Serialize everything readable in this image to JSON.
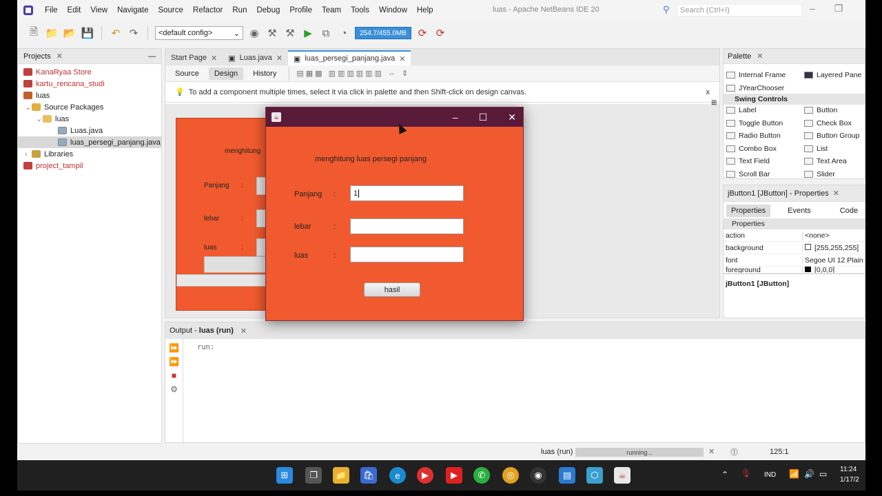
{
  "menubar": {
    "items": [
      "File",
      "Edit",
      "View",
      "Navigate",
      "Source",
      "Refactor",
      "Run",
      "Debug",
      "Profile",
      "Team",
      "Tools",
      "Window",
      "Help"
    ],
    "window_title": "luas - Apache NetBeans IDE 20",
    "search_placeholder": "Search (Ctrl+I)"
  },
  "toolbar": {
    "config": "<default config>",
    "memory": "254.7/455.0MB"
  },
  "projects": {
    "tab": "Projects",
    "items": [
      "KanaRyaa Store",
      "kartu_rencana_studi",
      "luas",
      "Source Packages",
      "luas",
      "Luas.java",
      "luas_persegi_panjang.java",
      "Libraries",
      "project_tampil"
    ]
  },
  "editor": {
    "tabs": [
      "Start Page",
      "Luas.java",
      "luas_persegi_panjang.java"
    ],
    "design_bar": [
      "Source",
      "Design",
      "History"
    ],
    "hint": "To add a component multiple times, select it via click in palette and then Shift-click on design canvas.",
    "hint_close": "x",
    "form": {
      "title": "menghitung",
      "labels": [
        "Panjang",
        ":",
        "lebar",
        ":",
        "luas",
        ":"
      ]
    }
  },
  "palette": {
    "tab": "Palette",
    "top_items": [
      "Internal Frame",
      "Layered Pane",
      "JYearChooser"
    ],
    "section": "Swing Controls",
    "items": [
      "Label",
      "Button",
      "Toggle Button",
      "Check Box",
      "Radio Button",
      "Button Group",
      "Combo Box",
      "List",
      "Text Field",
      "Text Area",
      "Scroll Bar",
      "Slider"
    ]
  },
  "properties": {
    "tab": "jButton1 [JButton] - Properties",
    "tabs": [
      "Properties",
      "Events",
      "Code"
    ],
    "section": "Properties",
    "rows": [
      {
        "name": "action",
        "value": "<none>"
      },
      {
        "name": "background",
        "value": "[255,255,255]"
      },
      {
        "name": "font",
        "value": "Segoe UI 12 Plain"
      },
      {
        "name": "foreground",
        "value": "[0,0,0]"
      }
    ],
    "footer": "jButton1 [JButton]"
  },
  "output": {
    "tab_prefix": "Output - ",
    "tab_bold": "luas (run)",
    "text": "run:"
  },
  "status": {
    "task": "luas (run)",
    "progress": "running...",
    "position": "125:1"
  },
  "dialog": {
    "heading": "menghitung luas persegi panjang",
    "labels": [
      "Panjang",
      "lebar",
      "luas"
    ],
    "colon": ":",
    "panjang_value": "1",
    "lebar_value": "",
    "luas_value": "",
    "button": "hasil"
  },
  "taskbar": {
    "lang": "IND",
    "time": "11:24",
    "date": "1/17/2"
  },
  "colors": {
    "form_orange": "#f05a2e",
    "dialog_titlebar": "#5a1a3a",
    "accent": "#3b8fd8"
  }
}
